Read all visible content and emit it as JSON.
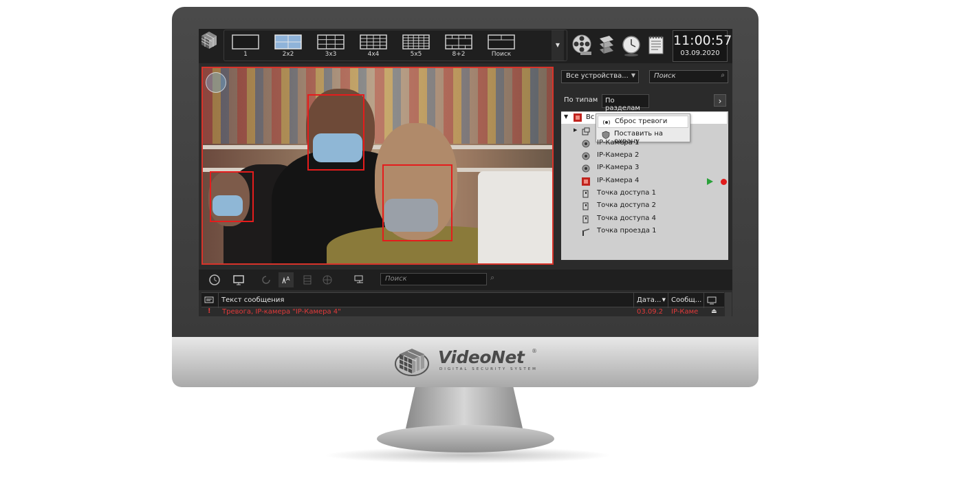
{
  "toolbar": {
    "layouts": [
      {
        "label": "1",
        "icon": "layout-1-icon"
      },
      {
        "label": "2x2",
        "icon": "layout-2x2-icon"
      },
      {
        "label": "3x3",
        "icon": "layout-3x3-icon"
      },
      {
        "label": "4x4",
        "icon": "layout-4x4-icon"
      },
      {
        "label": "5x5",
        "icon": "layout-5x5-icon"
      },
      {
        "label": "8+2",
        "icon": "layout-8plus2-icon"
      },
      {
        "label": "Поиск",
        "icon": "layout-search-icon"
      }
    ],
    "active_layout": "2x2",
    "time": "11:00:57",
    "date": "03.09.2020"
  },
  "devices": {
    "filter_value": "Все устройства...",
    "search_placeholder": "Поиск",
    "tabs": [
      {
        "label": "По типам",
        "active": false
      },
      {
        "label": "По разделам",
        "active": true
      }
    ],
    "root_label": "Вс",
    "context_menu": [
      {
        "label": "Сброс тревоги",
        "icon": "alarm-reset-icon",
        "highlighted": true
      },
      {
        "label": "Поставить на охрану",
        "icon": "arm-shield-icon",
        "highlighted": false
      }
    ],
    "items": [
      {
        "label": "IP-Камера 1",
        "icon": "camera-icon"
      },
      {
        "label": "IP-Камера 2",
        "icon": "camera-icon"
      },
      {
        "label": "IP-Камера 3",
        "icon": "camera-icon"
      },
      {
        "label": "IP-Камера 4",
        "icon": "camera-alarm-icon"
      },
      {
        "label": "Точка доступа 1",
        "icon": "access-point-icon"
      },
      {
        "label": "Точка доступа 2",
        "icon": "access-point-icon"
      },
      {
        "label": "Точка доступа 4",
        "icon": "access-point-icon"
      },
      {
        "label": "Точка проезда 1",
        "icon": "barrier-icon"
      }
    ]
  },
  "events": {
    "search_placeholder": "Поиск",
    "columns": [
      "Текст сообщения",
      "Дата...",
      "Сообщ..."
    ],
    "rows": [
      {
        "text": "Тревога, IP-камера \"IP-Камера 4\"",
        "date": "03.09.2",
        "source": "IP-Каме"
      }
    ]
  },
  "brand": {
    "name": "VideoNet",
    "tagline": "DIGITAL SECURITY SYSTEM",
    "reg": "®"
  },
  "colors": {
    "alarm": "#e01b1b",
    "play": "#2aa13a",
    "face_box": "#e51c1c"
  }
}
